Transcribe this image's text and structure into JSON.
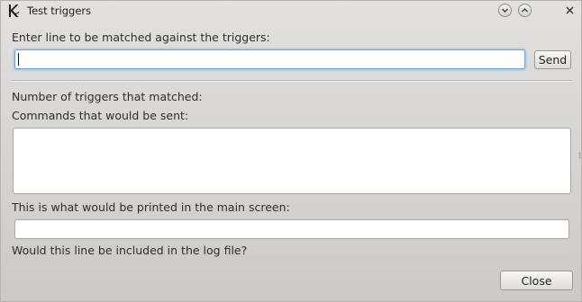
{
  "window": {
    "title": "Test triggers",
    "app_icon": "kde-app-icon",
    "controls": [
      "minimize-icon",
      "maximize-icon",
      "close-icon"
    ]
  },
  "form": {
    "enter_label": "Enter line to be matched against the triggers:",
    "line_value": "",
    "send_label": "Send",
    "count_label": "Number of triggers that matched:",
    "commands_label": "Commands that would be sent:",
    "commands_value": "",
    "printed_label": "This is what would be printed in the main screen:",
    "printed_value": "",
    "log_label": "Would this line be included in the log file?"
  },
  "footer": {
    "close_label": "Close"
  },
  "colors": {
    "focus_ring": "#6fa4d4",
    "window_bg": "#d9d7d5"
  }
}
